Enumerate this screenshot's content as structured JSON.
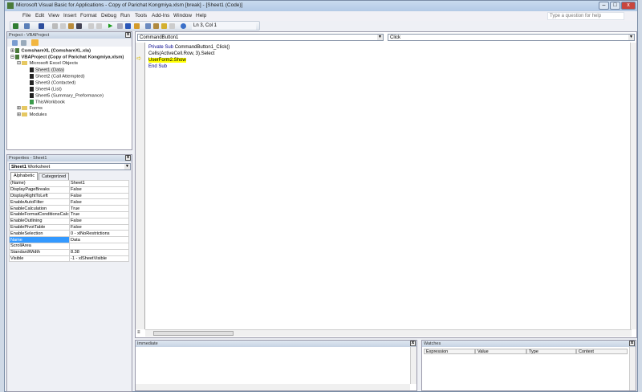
{
  "window": {
    "title": "Microsoft Visual Basic for Applications - Copy of Parichat Kongmiya.xlsm [break] - [Sheet1 (Code)]"
  },
  "menu": [
    "File",
    "Edit",
    "View",
    "Insert",
    "Format",
    "Debug",
    "Run",
    "Tools",
    "Add-Ins",
    "Window",
    "Help"
  ],
  "help_placeholder": "Type a question for help",
  "toolbar": {
    "position": "Ln 3, Col 1"
  },
  "project": {
    "title": "Project - VBAProject",
    "nodes": [
      {
        "label": "ComshareXL (ComshareXL.xla)",
        "bold": true
      },
      {
        "label": "VBAProject (Copy of Parichat Kongmiya.xlsm)",
        "bold": true
      },
      {
        "label": "Microsoft Excel Objects"
      },
      {
        "label": "Sheet1 (Data)"
      },
      {
        "label": "Sheet2 (Call Attempted)"
      },
      {
        "label": "Sheet3 (Contacted)"
      },
      {
        "label": "Sheet4 (List)"
      },
      {
        "label": "Sheet5 (Summary_Preformance)"
      },
      {
        "label": "ThisWorkbook"
      },
      {
        "label": "Forms"
      },
      {
        "label": "Modules"
      }
    ]
  },
  "properties": {
    "title": "Properties - Sheet1",
    "object_name": "Sheet1",
    "object_type": "Worksheet",
    "tabs": [
      "Alphabetic",
      "Categorized"
    ],
    "rows": [
      {
        "name": "(Name)",
        "value": "Sheet1"
      },
      {
        "name": "DisplayPageBreaks",
        "value": "False"
      },
      {
        "name": "DisplayRightToLeft",
        "value": "False"
      },
      {
        "name": "EnableAutoFilter",
        "value": "False"
      },
      {
        "name": "EnableCalculation",
        "value": "True"
      },
      {
        "name": "EnableFormatConditionsCalculation",
        "value": "True"
      },
      {
        "name": "EnableOutlining",
        "value": "False"
      },
      {
        "name": "EnablePivotTable",
        "value": "False"
      },
      {
        "name": "EnableSelection",
        "value": "0 - xlNoRestrictions"
      },
      {
        "name": "Name",
        "value": "Data",
        "selected": true
      },
      {
        "name": "ScrollArea",
        "value": ""
      },
      {
        "name": "StandardWidth",
        "value": "8.38"
      },
      {
        "name": "Visible",
        "value": "-1 - xlSheetVisible"
      }
    ]
  },
  "code": {
    "object_combo": "CommandButton1",
    "proc_combo": "Click",
    "lines": [
      {
        "kw": "Private Sub ",
        "text": "CommandButton1_Click()"
      },
      {
        "kw": "",
        "text": "Cells(ActiveCell.Row, 3).Select"
      },
      {
        "kw": "",
        "text": "UserForm2.Show",
        "highlight": true
      },
      {
        "kw": "End Sub",
        "text": ""
      }
    ]
  },
  "immediate": {
    "title": "Immediate"
  },
  "watches": {
    "title": "Watches",
    "columns": [
      "Expression",
      "Value",
      "Type",
      "Context"
    ]
  }
}
